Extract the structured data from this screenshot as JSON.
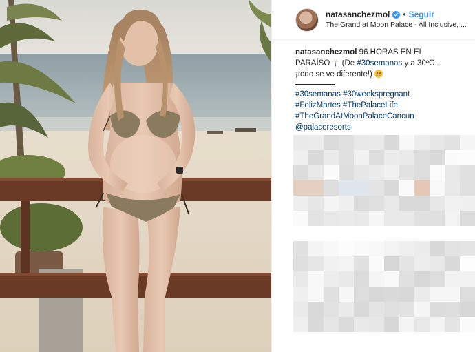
{
  "header": {
    "username": "natasanchezmol",
    "separator": "•",
    "follow_label": "Seguir",
    "location": "The Grand at Moon Palace - All Inclusive, ..."
  },
  "caption": {
    "username": "natasanchezmol",
    "text_1": " 96 HORAS EN EL PARAÍSO ",
    "text_2": " (De ",
    "hashtag_1": "#30semanas",
    "text_3": " y a 30ºC... ¡todo se ve diferente!) "
  },
  "hashtags": {
    "line_1a": "#30semanas",
    "line_1b": "#30weekspregnant",
    "line_2a": "#FelizMartes",
    "line_2b": "#ThePalaceLife",
    "line_3": "#TheGrandAtMoonPalaceCancun",
    "line_4": "@palaceresorts"
  },
  "icons": {
    "verified": "verified-badge-icon",
    "palm_tree": "palm-tree-icon",
    "smile": "smiling-face-icon"
  },
  "colors": {
    "link": "#003569",
    "follow": "#3897f0",
    "verified": "#3897f0",
    "text": "#262626"
  }
}
